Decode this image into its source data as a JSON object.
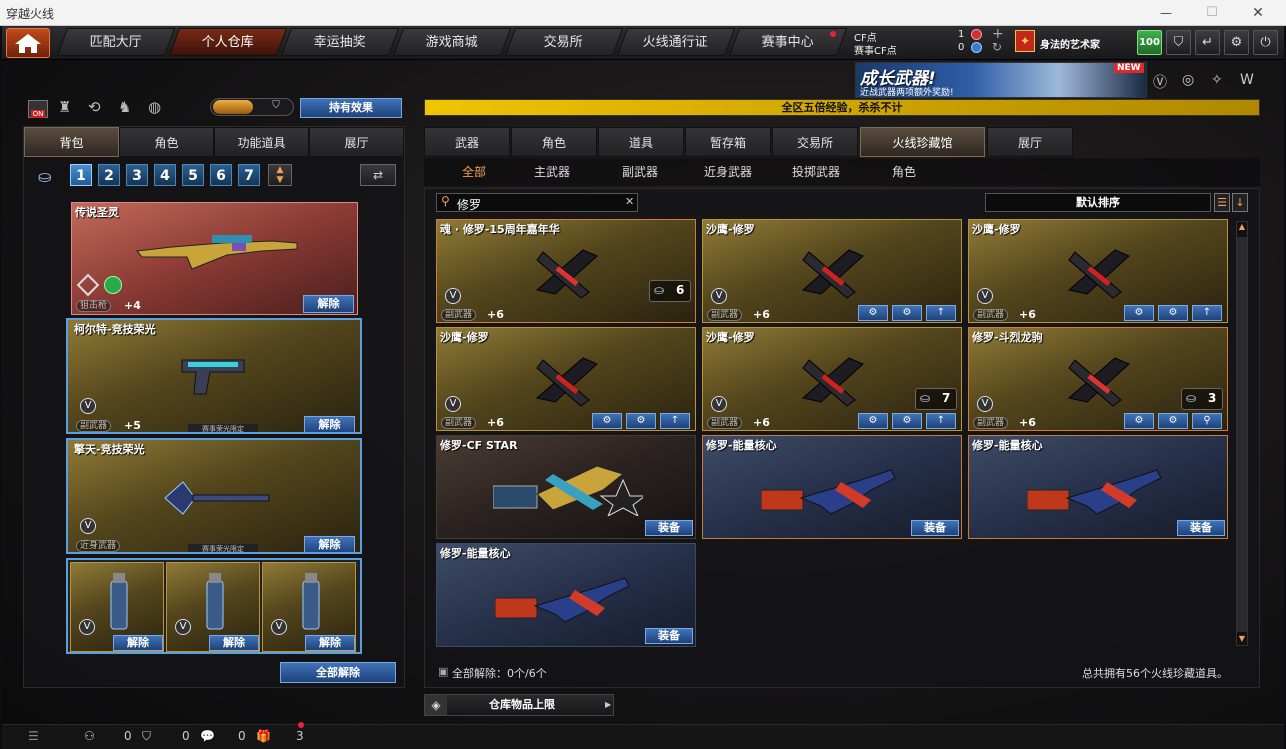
{
  "window": {
    "title": "穿越火线",
    "min": "—",
    "max": "☐",
    "close": "✕"
  },
  "nav": {
    "tabs": [
      "匹配大厅",
      "个人仓库",
      "幸运抽奖",
      "游戏商城",
      "交易所",
      "火线通行证",
      "赛事中心"
    ],
    "active": 1
  },
  "topinfo": {
    "cf_label": "CF点",
    "cf_value": "1",
    "race_label": "赛事CF点",
    "race_value": "0",
    "username": "身法的艺术家",
    "level": "100"
  },
  "banner": {
    "title": "成长武器!",
    "subtitle": "近战武器两项额外奖励!",
    "badge": "NEW",
    "ticker": "全区五倍经验，杀杀不计"
  },
  "left": {
    "effect_button": "持有效果",
    "tabs": [
      "背包",
      "角色",
      "功能道具",
      "展厅"
    ],
    "active_tab": 0,
    "pages": [
      "1",
      "2",
      "3",
      "4",
      "5",
      "6",
      "7"
    ],
    "active_page": 0,
    "slots": [
      {
        "name": "传说圣灵",
        "type": "狙击枪",
        "plus": "+4",
        "button": "解除"
      },
      {
        "name": "柯尔特-竞技荣光",
        "type": "副武器",
        "plus": "+5",
        "button": "解除",
        "ribbon": "赛事荣光限定"
      },
      {
        "name": "擎天-竞技荣光",
        "type": "近身武器",
        "plus": "",
        "button": "解除",
        "ribbon": "赛事荣光限定"
      }
    ],
    "grenade_buttons": [
      "解除",
      "解除",
      "解除"
    ],
    "unequip_all": "全部解除"
  },
  "right": {
    "tabs": [
      "武器",
      "角色",
      "道具",
      "暂存箱",
      "交易所",
      "火线珍藏馆",
      "展厅"
    ],
    "active_tab": 5,
    "subtabs": [
      "全部",
      "主武器",
      "副武器",
      "近身武器",
      "投掷武器",
      "角色"
    ],
    "active_subtab": 0,
    "search": {
      "value": "修罗",
      "clear": "✕"
    },
    "sort": "默认排序",
    "items": [
      {
        "name": "魂 · 修罗-15周年嘉年华",
        "type": "副武器",
        "plus": "+6",
        "count": "6",
        "style": "red"
      },
      {
        "name": "沙鹰-修罗",
        "type": "副武器",
        "plus": "+6",
        "style": "gold"
      },
      {
        "name": "沙鹰-修罗",
        "type": "副武器",
        "plus": "+6",
        "style": "gold"
      },
      {
        "name": "沙鹰-修罗",
        "type": "副武器",
        "plus": "+6",
        "style": "gold"
      },
      {
        "name": "沙鹰-修罗",
        "type": "副武器",
        "plus": "+6",
        "count": "7",
        "style": "gold"
      },
      {
        "name": "修罗-斗烈龙驹",
        "type": "副武器",
        "plus": "+6",
        "count": "3",
        "style": "red"
      },
      {
        "name": "修罗-CF STAR",
        "button": "装备",
        "style": "dark"
      },
      {
        "name": "修罗-能量核心",
        "button": "装备",
        "style": "blue"
      },
      {
        "name": "修罗-能量核心",
        "button": "装备",
        "style": "blue"
      },
      {
        "name": "修罗-能量核心",
        "button": "装备",
        "style": "blue2"
      }
    ],
    "footer_left": "全部解除：0个/6个",
    "footer_right": "总共拥有56个火线珍藏道具。",
    "storage_button": "仓库物品上限"
  },
  "bottom": {
    "friends": "0",
    "shield": "0",
    "chat": "0",
    "gift": "3"
  },
  "colors": {
    "accent": "#f0a15a",
    "button_blue": "#3f73b8",
    "gold": "#b8953c"
  }
}
